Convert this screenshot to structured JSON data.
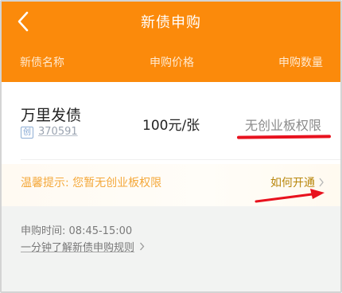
{
  "header": {
    "title": "新债申购",
    "back_icon": "chevron-left-icon"
  },
  "columns": {
    "name": "新债名称",
    "price": "申购价格",
    "quantity": "申购数量"
  },
  "bond": {
    "name": "万里发债",
    "board_badge": "创",
    "code": "370591",
    "price": "100元/张",
    "quantity": "无创业板权限"
  },
  "tip": {
    "text": "温馨提示: 您暂无创业板权限",
    "link_label": "如何开通"
  },
  "info": {
    "time_label": "申购时间:",
    "time_value": "08:45-15:00",
    "rules_link": "一分钟了解新债申购规则"
  },
  "colors": {
    "header": "#fb8a0b",
    "annotation": "#e8121e",
    "tip_text": "#f4a83a",
    "link": "#b8860b"
  }
}
